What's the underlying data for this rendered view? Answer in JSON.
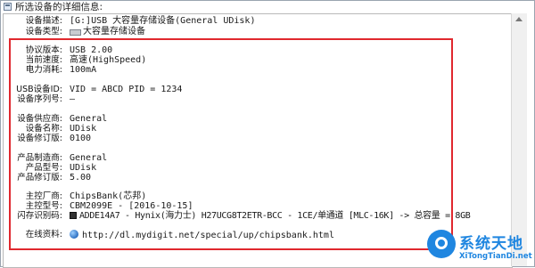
{
  "window": {
    "title": "所选设备的详细信息:"
  },
  "device": {
    "description_label": "设备描述:",
    "description_value": "[G:]USB 大容量存储设备(General UDisk)",
    "type_label": "设备类型:",
    "type_value": "大容量存储设备"
  },
  "protocol": {
    "version_label": "协议版本:",
    "version_value": "USB 2.00",
    "speed_label": "当前速度:",
    "speed_value": "高速(HighSpeed)",
    "power_label": "电力消耗:",
    "power_value": "100mA"
  },
  "ids": {
    "usb_id_label": "USB设备ID:",
    "usb_id_value": "VID = ABCD PID = 1234",
    "serial_label": "设备序列号:",
    "serial_value": "—"
  },
  "vendor": {
    "vendor_label": "设备供应商:",
    "vendor_value": "General",
    "name_label": "设备名称:",
    "name_value": "UDisk",
    "revision_label": "设备修订版:",
    "revision_value": "0100"
  },
  "product": {
    "manufacturer_label": "产品制造商:",
    "manufacturer_value": "General",
    "model_label": "产品型号:",
    "model_value": "UDisk",
    "revision_label": "产品修订版:",
    "revision_value": "5.00"
  },
  "controller": {
    "vendor_label": "主控厂商:",
    "vendor_value": "ChipsBank(芯邦)",
    "model_label": "主控型号:",
    "model_value": "CBM2099E - [2016-10-15]",
    "flash_label": "闪存识别码:",
    "flash_value": "ADDE14A7 - Hynix(海力士) H27UCG8T2ETR-BCC - 1CE/单通道 [MLC-16K] -> 总容量 = 8GB"
  },
  "online": {
    "label": "在线资料:",
    "link": "http://dl.mydigit.net/special/up/chipsbank.html"
  },
  "watermark": {
    "title": "系统天地",
    "subtitle": "XiTongTianDi.net"
  },
  "colors": {
    "highlight_border": "#e0282e",
    "brand": "#1f86e0"
  },
  "icons": {
    "device_type": "usb-drive-icon",
    "flash": "chip-icon",
    "online": "globe-icon"
  }
}
